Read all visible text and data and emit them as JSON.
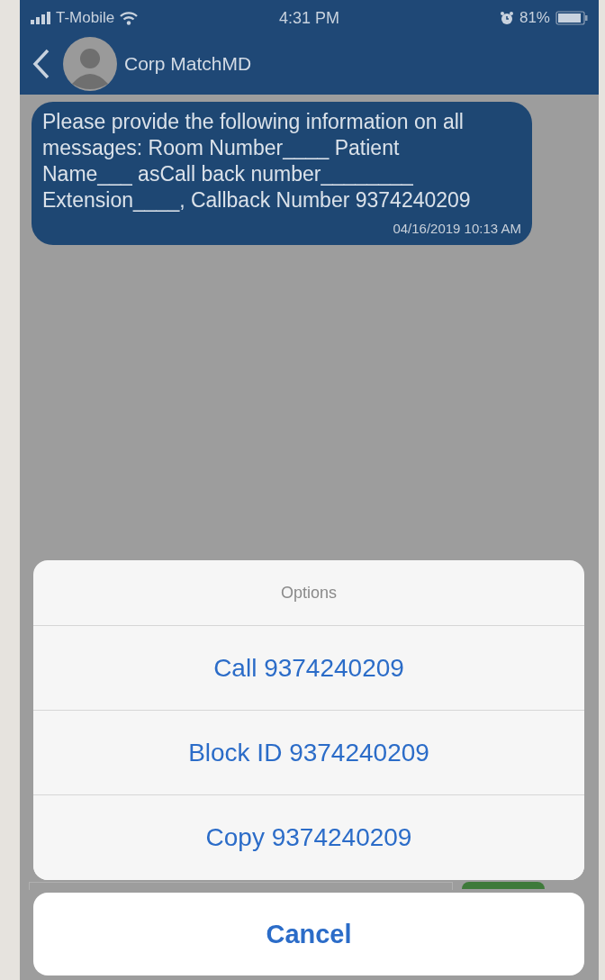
{
  "status_bar": {
    "carrier": "T-Mobile",
    "time": "4:31 PM",
    "battery": "81%"
  },
  "header": {
    "title": "Corp MatchMD"
  },
  "messages": [
    {
      "text": "Please provide the following information on all messages: Room Number____ Patient Name___ asCall back number________ Extension____, Callback Number 9374240209",
      "timestamp": "04/16/2019 10:13 AM"
    }
  ],
  "action_sheet": {
    "title": "Options",
    "actions": [
      "Call 9374240209",
      "Block ID 9374240209",
      "Copy 9374240209"
    ],
    "cancel": "Cancel"
  }
}
